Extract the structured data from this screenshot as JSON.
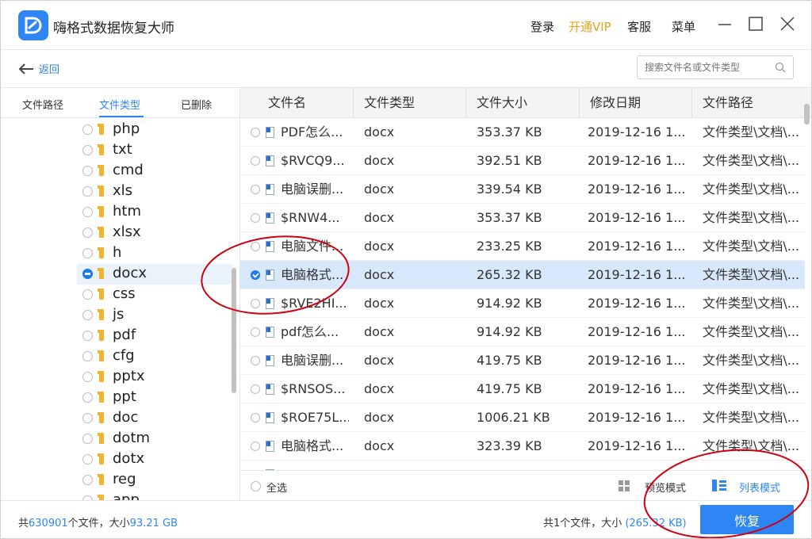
{
  "app": {
    "title": "嗨格式数据恢复大师"
  },
  "titlebar": {
    "login": "登录",
    "vip": "开通VIP",
    "service": "客服",
    "menu": "菜单"
  },
  "nav": {
    "back": "返回",
    "search_placeholder": "搜索文件名或文件类型"
  },
  "left_tabs": [
    {
      "label": "文件路径"
    },
    {
      "label": "文件类型"
    },
    {
      "label": "已删除"
    }
  ],
  "tree": [
    {
      "label": "php"
    },
    {
      "label": "txt"
    },
    {
      "label": "cmd"
    },
    {
      "label": "xls"
    },
    {
      "label": "htm"
    },
    {
      "label": "xlsx"
    },
    {
      "label": "h"
    },
    {
      "label": "docx"
    },
    {
      "label": "css"
    },
    {
      "label": "js"
    },
    {
      "label": "pdf"
    },
    {
      "label": "cfg"
    },
    {
      "label": "pptx"
    },
    {
      "label": "ppt"
    },
    {
      "label": "doc"
    },
    {
      "label": "dotm"
    },
    {
      "label": "dotx"
    },
    {
      "label": "reg"
    },
    {
      "label": "app"
    }
  ],
  "table": {
    "columns": [
      "文件名",
      "文件类型",
      "文件大小",
      "修改日期",
      "文件路径"
    ],
    "rows": [
      {
        "name": "PDF怎么...",
        "type": "docx",
        "size": "353.37 KB",
        "date": "2019-12-16 1...",
        "path": "文件类型\\文档\\..."
      },
      {
        "name": "$RVCQ9...",
        "type": "docx",
        "size": "392.51 KB",
        "date": "2019-12-16 1...",
        "path": "文件类型\\文档\\..."
      },
      {
        "name": "电脑误删...",
        "type": "docx",
        "size": "339.54 KB",
        "date": "2019-12-16 1...",
        "path": "文件类型\\文档\\..."
      },
      {
        "name": "$RNW4...",
        "type": "docx",
        "size": "353.37 KB",
        "date": "2019-12-16 1...",
        "path": "文件类型\\文档\\..."
      },
      {
        "name": "电脑文件...",
        "type": "docx",
        "size": "233.25 KB",
        "date": "2019-12-16 1...",
        "path": "文件类型\\文档\\..."
      },
      {
        "name": "电脑格式...",
        "type": "docx",
        "size": "265.32 KB",
        "date": "2019-12-16 1...",
        "path": "文件类型\\文档\\..."
      },
      {
        "name": "$RVE2HI...",
        "type": "docx",
        "size": "914.92 KB",
        "date": "2019-12-16 1...",
        "path": "文件类型\\文档\\..."
      },
      {
        "name": "pdf怎么...",
        "type": "docx",
        "size": "914.92 KB",
        "date": "2019-12-16 1...",
        "path": "文件类型\\文档\\..."
      },
      {
        "name": "电脑误删...",
        "type": "docx",
        "size": "419.75 KB",
        "date": "2019-12-16 1...",
        "path": "文件类型\\文档\\..."
      },
      {
        "name": "$RNSOS...",
        "type": "docx",
        "size": "419.75 KB",
        "date": "2019-12-16 1...",
        "path": "文件类型\\文档\\..."
      },
      {
        "name": "$ROE75L...",
        "type": "docx",
        "size": "1006.21 KB",
        "date": "2019-12-16 1...",
        "path": "文件类型\\文档\\..."
      },
      {
        "name": "电脑格式...",
        "type": "docx",
        "size": "323.39 KB",
        "date": "2019-12-16 1...",
        "path": "文件类型\\文档\\..."
      },
      {
        "name": "",
        "type": "",
        "size": "",
        "date": "",
        "path": ""
      }
    ]
  },
  "footer": {
    "select_all": "全选",
    "preview_mode": "预览模式",
    "list_mode": "列表模式"
  },
  "status": {
    "total_prefix": "共",
    "total_count": "630901",
    "total_mid": "个文件，大小",
    "total_size": "93.21 GB",
    "selected_text": "共1个文件，大小",
    "selected_size": "(265.32 KB)",
    "recover": "恢复"
  },
  "colors": {
    "accent": "#2d86f4",
    "vip": "#e8a21c",
    "annotation": "#d00010",
    "selected_row": "#d7e8fb"
  }
}
